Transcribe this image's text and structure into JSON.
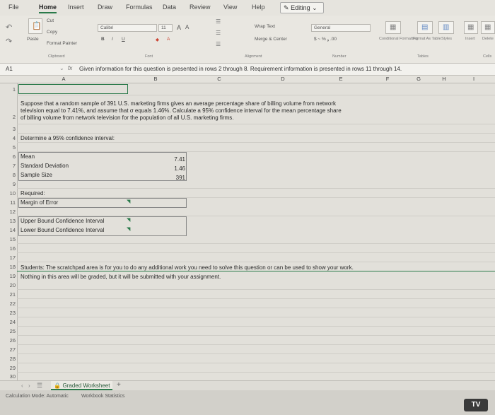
{
  "ribbon_tabs": [
    "File",
    "Home",
    "Insert",
    "Draw",
    "Formulas",
    "Data",
    "Review",
    "View",
    "Help"
  ],
  "editing_label": "Editing",
  "clipboard": {
    "cut": "Cut",
    "copy": "Copy",
    "format_painter": "Format Painter",
    "paste": "Paste",
    "group": "Clipboard"
  },
  "font": {
    "name": "Calibri",
    "size": "11",
    "group": "Font"
  },
  "alignment": {
    "wrap": "Wrap Text",
    "merge": "Merge & Center",
    "group": "Alignment"
  },
  "number": {
    "format": "General",
    "group": "Number"
  },
  "styles": {
    "conditional": "Conditional Formatting",
    "format_table": "Format As Table",
    "cell_styles": "Styles",
    "group": "Tables"
  },
  "cells": {
    "insert": "Insert",
    "delete": "Delete",
    "group": "Cells"
  },
  "name_box": "A1",
  "formula": "Given information for this question is presented in rows 2 through 8. Requirement information is presented in rows 11 through 14.",
  "columns": [
    "A",
    "B",
    "C",
    "D",
    "E",
    "F",
    "G",
    "H",
    "I"
  ],
  "rows": [
    "1",
    "2",
    "3",
    "4",
    "5",
    "6",
    "7",
    "8",
    "9",
    "10",
    "11",
    "12",
    "13",
    "14",
    "15",
    "16",
    "17",
    "18",
    "19",
    "20",
    "21",
    "22",
    "23",
    "24",
    "25",
    "26",
    "27",
    "28",
    "29",
    "30"
  ],
  "question": {
    "line1": "Suppose that a random sample of 391 U.S. marketing firms gives an average percentage share of billing volume from network",
    "line2": "television equal to 7.41%, and assume that σ equals 1.46%. Calculate a 95% confidence interval for the mean percentage share",
    "line3": "of billing volume from network television for the population of all U.S. marketing firms."
  },
  "determine": "Determine a 95% confidence interval:",
  "given": [
    {
      "label": "Mean",
      "value": "7.41"
    },
    {
      "label": "Standard Deviation",
      "value": "1.46"
    },
    {
      "label": "Sample Size",
      "value": "391"
    }
  ],
  "required_label": "Required:",
  "margin_label": "Margin of Error",
  "upper_label": "Upper Bound Confidence Interval",
  "lower_label": "Lower Bound Confidence Interval",
  "scratch1": "Students: The scratchpad area is for you to do any additional work you need to solve this question or can be used to show your work.",
  "scratch2": "Nothing in this area will be graded, but it will be submitted with your assignment.",
  "sheet_tab": "Graded Worksheet",
  "status": {
    "calc_mode": "Calculation Mode: Automatic",
    "stats": "Workbook Statistics"
  },
  "tv_badge": "TV"
}
